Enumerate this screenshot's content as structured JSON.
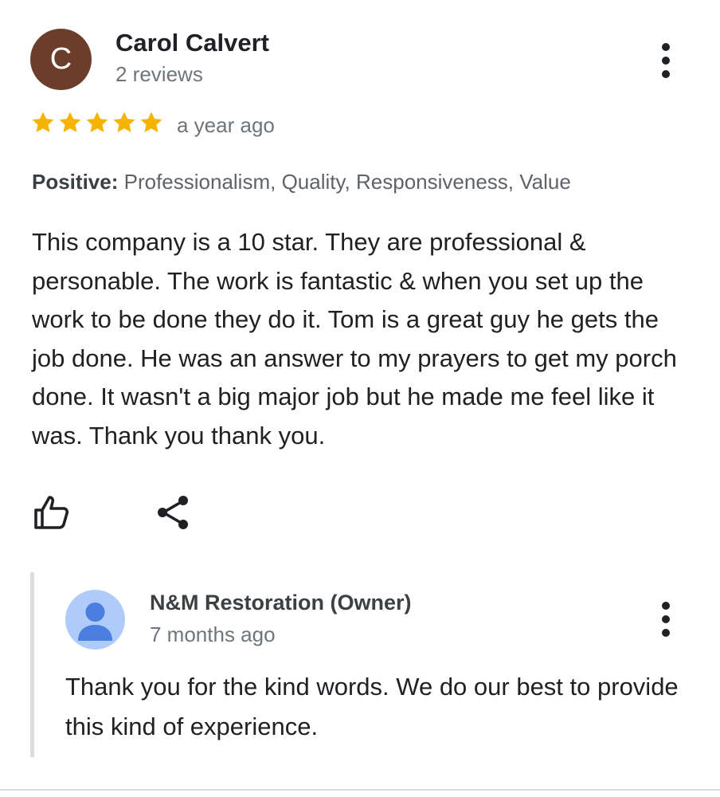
{
  "review": {
    "avatar_initial": "C",
    "author_name": "Carol Calvert",
    "author_review_count": "2 reviews",
    "rating": 5,
    "rating_max": 5,
    "time_ago": "a year ago",
    "positive_label": "Positive:",
    "positive_values": "Professionalism, Quality, Responsiveness, Value",
    "text": "This company is a 10 star. They are professional & personable. The work is fantastic & when you set up the work to be done they do it. Tom is a great guy he gets the job done. He was an answer to my prayers to get my porch done. It wasn't a big major job but he made me feel like it was. Thank you thank you."
  },
  "actions": {
    "like_icon": "thumb-up-icon",
    "share_icon": "share-icon",
    "more_icon": "more-vert-icon"
  },
  "owner_reply": {
    "name": "N&M Restoration (Owner)",
    "time_ago": "7 months ago",
    "text": "Thank you for the kind words. We do our best to provide this kind of experience.",
    "avatar_icon": "person-avatar-icon"
  },
  "colors": {
    "avatar_bg": "#6b3e2c",
    "star": "#f4b400",
    "owner_avatar_bg": "#aecbfa",
    "owner_avatar_figure": "#4a7fe0",
    "muted_text": "#70757a",
    "reply_bar": "#dadce0"
  }
}
